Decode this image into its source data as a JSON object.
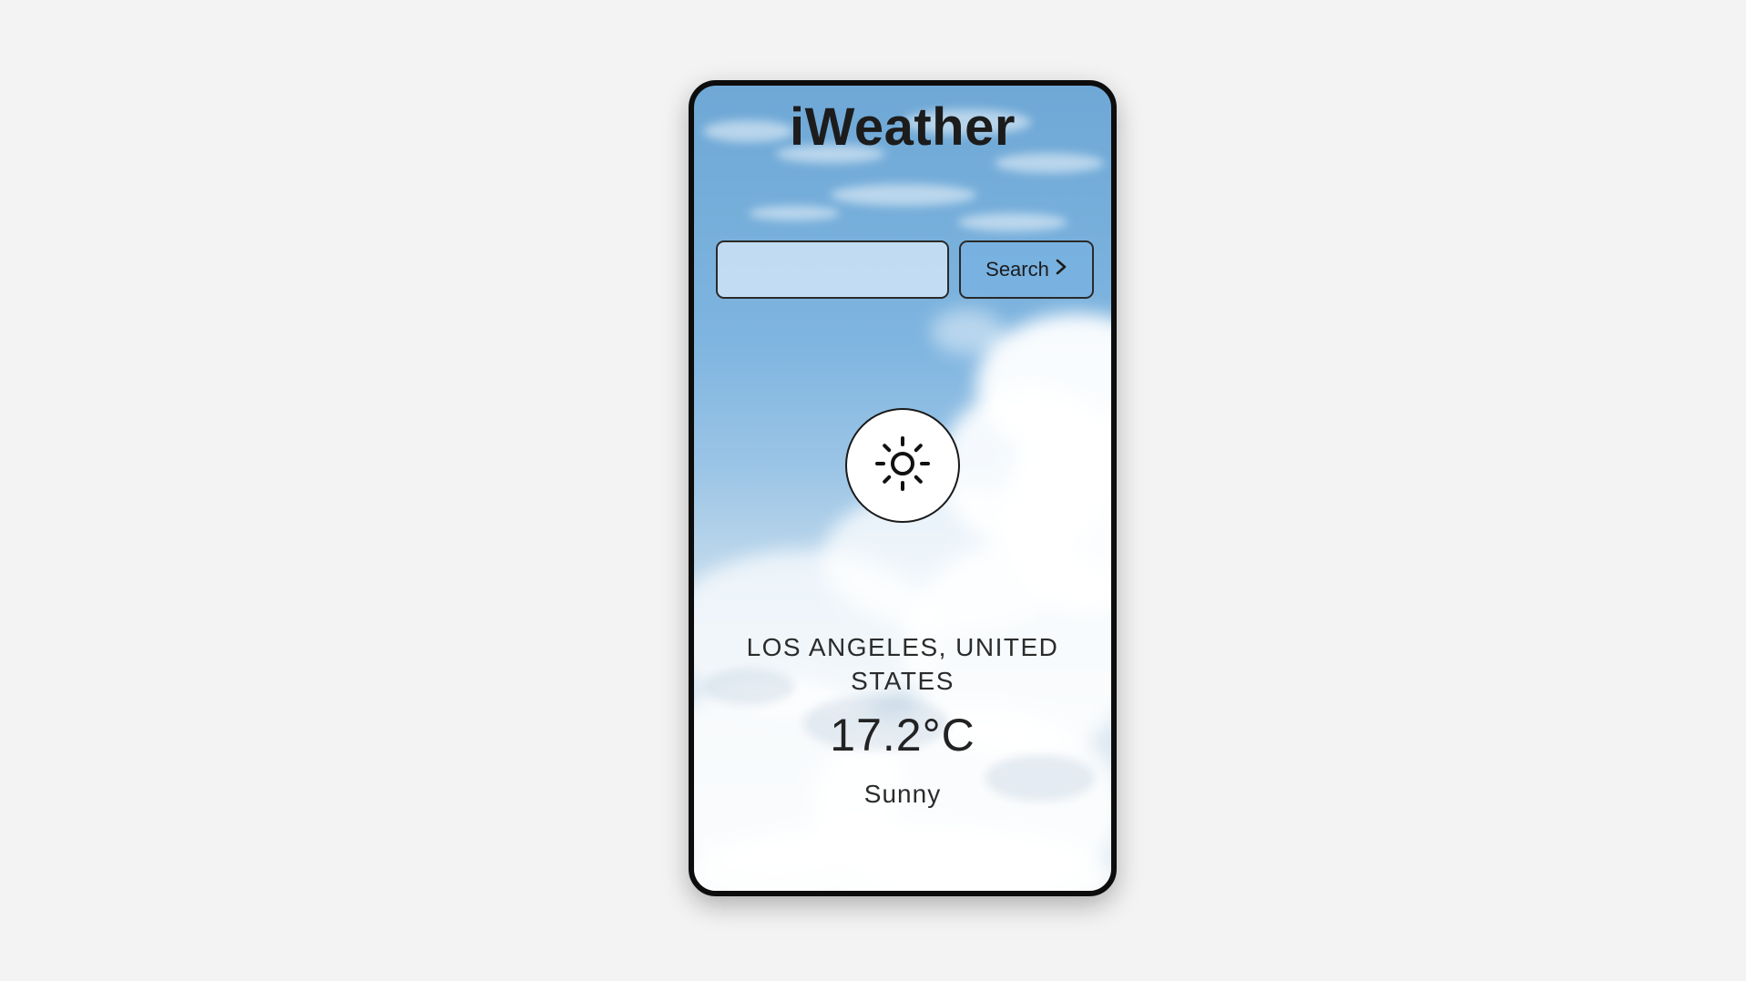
{
  "app": {
    "title": "iWeather"
  },
  "search": {
    "input_value": "",
    "button_label": "Search",
    "button_icon": "chevron-right-icon"
  },
  "weather": {
    "icon": "sun-icon",
    "location": "LOS ANGELES, UNITED STATES",
    "temperature": "17.2°C",
    "condition": "Sunny"
  },
  "colors": {
    "page_background": "#f3f3f3",
    "sky_top": "#6fa8d6",
    "sky_bottom": "#e3ecf3",
    "frame": "#0d0d0d",
    "text": "#222222"
  }
}
